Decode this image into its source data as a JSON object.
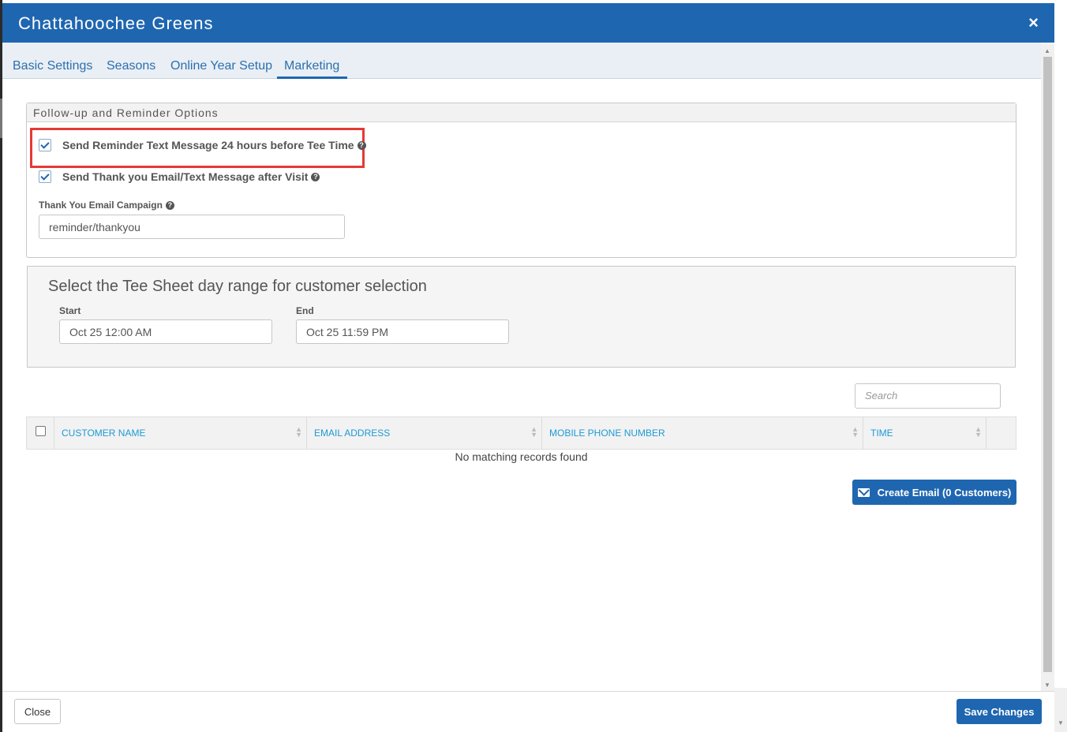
{
  "window": {
    "title": "Chattahoochee Greens",
    "close_symbol": "×"
  },
  "tabs": [
    {
      "label": "Basic Settings"
    },
    {
      "label": "Seasons"
    },
    {
      "label": "Online Year Setup"
    },
    {
      "label": "Marketing",
      "active": true
    }
  ],
  "followup": {
    "heading": "Follow-up and Reminder Options",
    "reminder_label": "Send Reminder Text Message 24 hours before Tee Time",
    "reminder_checked": true,
    "thankyou_label": "Send Thank you Email/Text Message after Visit",
    "thankyou_checked": true,
    "campaign_label": "Thank You Email Campaign",
    "campaign_value": "reminder/thankyou"
  },
  "range": {
    "title": "Select the Tee Sheet day range for customer selection",
    "start_label": "Start",
    "start_value": "Oct 25 12:00 AM",
    "end_label": "End",
    "end_value": "Oct 25 11:59 PM"
  },
  "search": {
    "placeholder": "Search"
  },
  "table": {
    "columns": [
      "CUSTOMER NAME",
      "EMAIL ADDRESS",
      "MOBILE PHONE NUMBER",
      "TIME"
    ],
    "empty_message": "No matching records found"
  },
  "actions": {
    "create_email_label": "Create Email (0 Customers)",
    "close_label": "Close",
    "save_label": "Save Changes"
  },
  "colors": {
    "primary": "#1f66b0",
    "link": "#1d9ad6",
    "highlight": "#e53935"
  },
  "icons": {
    "help": "question-circle-icon",
    "envelope": "envelope-icon",
    "close": "close-icon",
    "sort": "sort-icon"
  }
}
